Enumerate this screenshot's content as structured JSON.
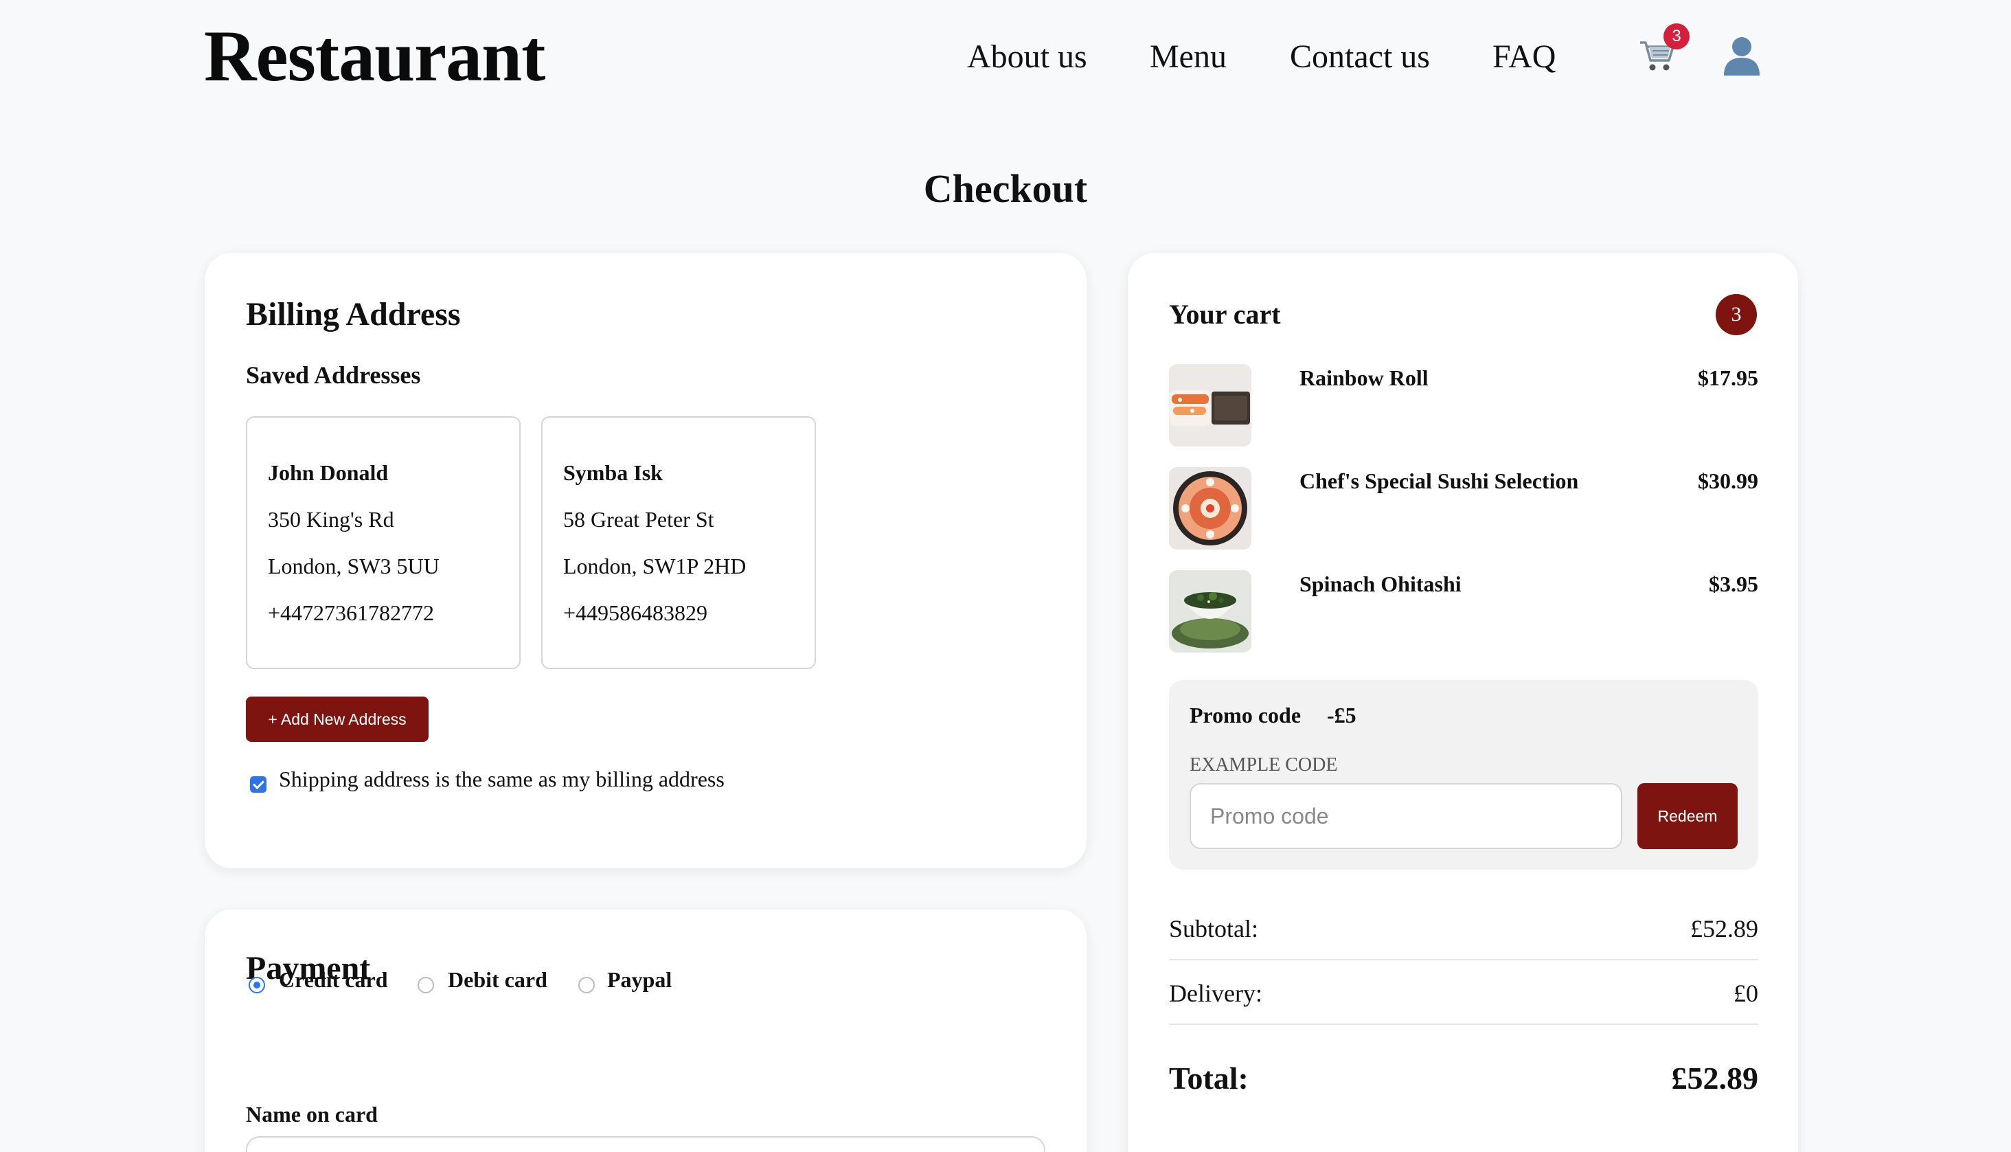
{
  "header": {
    "logo": "Restaurant",
    "nav": [
      "About us",
      "Menu",
      "Contact us",
      "FAQ"
    ],
    "cart_badge": "3"
  },
  "page_title": "Checkout",
  "billing": {
    "title": "Billing Address",
    "saved_title": "Saved Addresses",
    "addresses": [
      {
        "name": "John Donald",
        "line1": "350 King's Rd",
        "line2": "London, SW3 5UU",
        "phone": "+44727361782772"
      },
      {
        "name": "Symba Isk",
        "line1": "58 Great Peter St",
        "line2": "London, SW1P 2HD",
        "phone": "+449586483829"
      }
    ],
    "add_button": "+ Add New Address",
    "same_address_label": "Shipping address is the same as my billing address",
    "same_address_checked": true
  },
  "payment": {
    "title": "Payment",
    "methods": [
      "Credit card",
      "Debit card",
      "Paypal"
    ],
    "selected_method": "Credit card",
    "name_label": "Name on card"
  },
  "cart": {
    "title": "Your cart",
    "count": "3",
    "items": [
      {
        "name": "Rainbow Roll",
        "price": "$17.95"
      },
      {
        "name": "Chef's Special Sushi Selection",
        "price": "$30.99"
      },
      {
        "name": "Spinach Ohitashi",
        "price": "$3.95"
      }
    ],
    "promo": {
      "title": "Promo code",
      "discount": "-£5",
      "example": "EXAMPLE CODE",
      "placeholder": "Promo code",
      "button": "Redeem"
    },
    "subtotal_label": "Subtotal:",
    "subtotal": "£52.89",
    "delivery_label": "Delivery:",
    "delivery": "£0",
    "total_label": "Total:",
    "total": "£52.89"
  },
  "colors": {
    "accent": "#7d1410",
    "badge": "#d61f3c",
    "control_blue": "#2e73e8",
    "background": "#f8f9fb"
  }
}
